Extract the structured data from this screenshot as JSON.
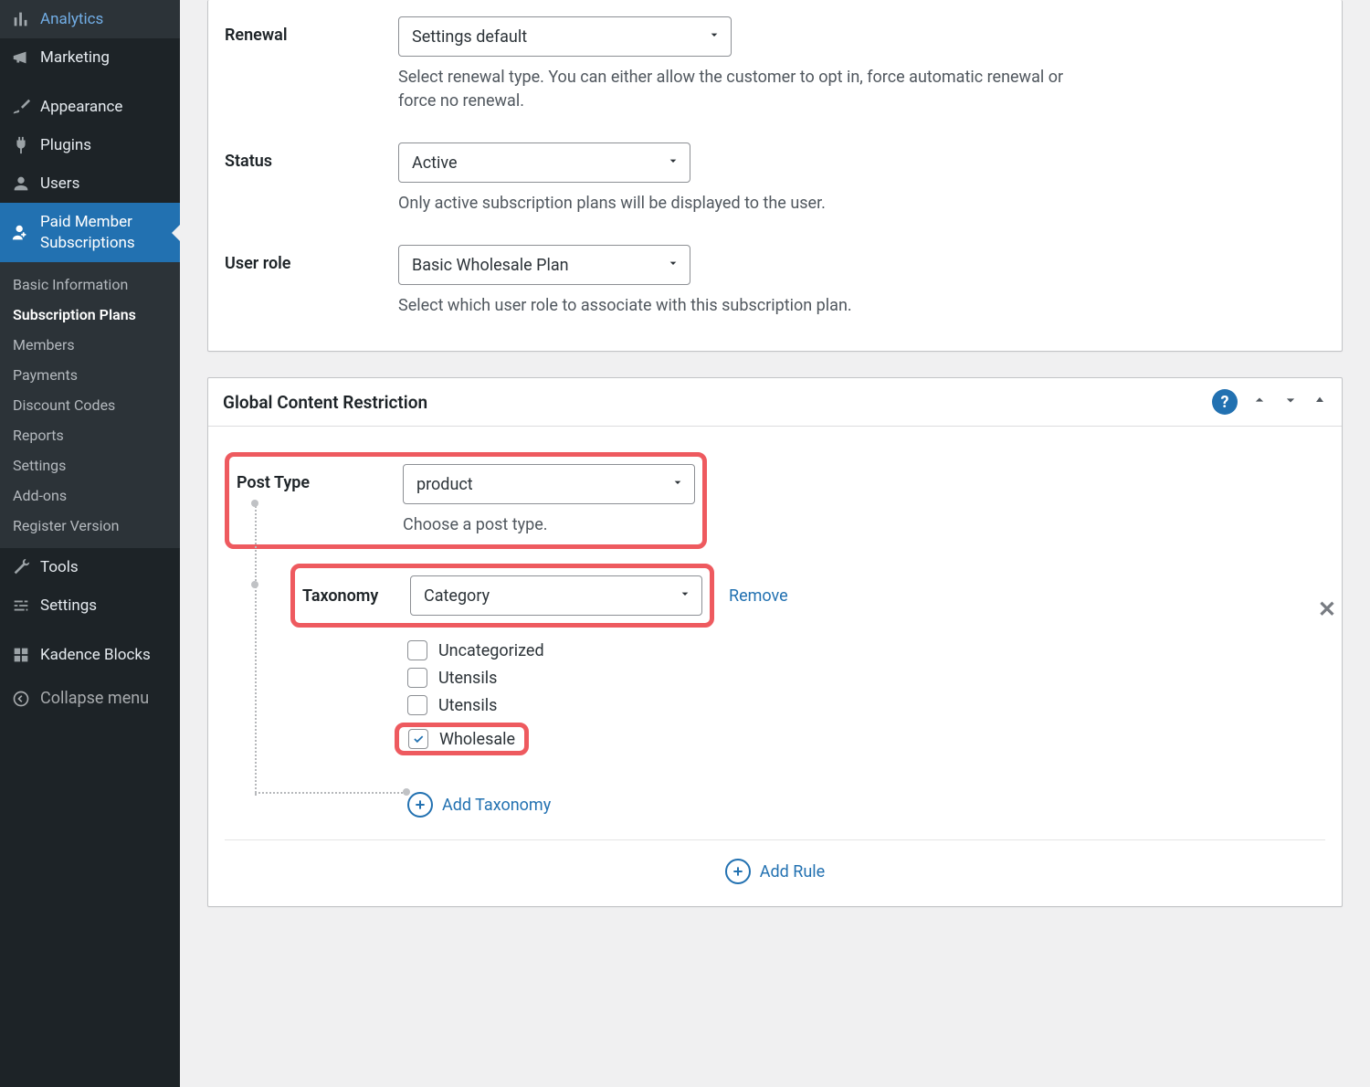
{
  "sidebar": {
    "main": [
      {
        "id": "analytics",
        "label": "Analytics"
      },
      {
        "id": "marketing",
        "label": "Marketing"
      },
      {
        "id": "appearance",
        "label": "Appearance"
      },
      {
        "id": "plugins",
        "label": "Plugins"
      },
      {
        "id": "users",
        "label": "Users"
      },
      {
        "id": "pms",
        "label": "Paid Member Subscriptions",
        "active": true
      },
      {
        "id": "tools",
        "label": "Tools"
      },
      {
        "id": "settings",
        "label": "Settings"
      },
      {
        "id": "kadence",
        "label": "Kadence Blocks"
      }
    ],
    "sub": [
      {
        "label": "Basic Information"
      },
      {
        "label": "Subscription Plans",
        "current": true
      },
      {
        "label": "Members"
      },
      {
        "label": "Payments"
      },
      {
        "label": "Discount Codes"
      },
      {
        "label": "Reports"
      },
      {
        "label": "Settings"
      },
      {
        "label": "Add-ons"
      },
      {
        "label": "Register Version"
      }
    ],
    "collapse": "Collapse menu"
  },
  "form": {
    "renewal": {
      "label": "Renewal",
      "value": "Settings default",
      "help": "Select renewal type. You can either allow the customer to opt in, force automatic renewal or force no renewal."
    },
    "status": {
      "label": "Status",
      "value": "Active",
      "help": "Only active subscription plans will be displayed to the user."
    },
    "user_role": {
      "label": "User role",
      "value": "Basic Wholesale Plan",
      "help": "Select which user role to associate with this subscription plan."
    }
  },
  "gcr": {
    "title": "Global Content Restriction",
    "help_symbol": "?",
    "post_type": {
      "label": "Post Type",
      "value": "product",
      "help": "Choose a post type."
    },
    "taxonomy": {
      "label": "Taxonomy",
      "value": "Category",
      "remove": "Remove",
      "options": [
        {
          "label": "Uncategorized",
          "checked": false
        },
        {
          "label": "Utensils",
          "checked": false
        },
        {
          "label": "Utensils",
          "checked": false
        },
        {
          "label": "Wholesale",
          "checked": true
        }
      ]
    },
    "add_taxonomy": "Add Taxonomy",
    "add_rule": "Add Rule"
  }
}
